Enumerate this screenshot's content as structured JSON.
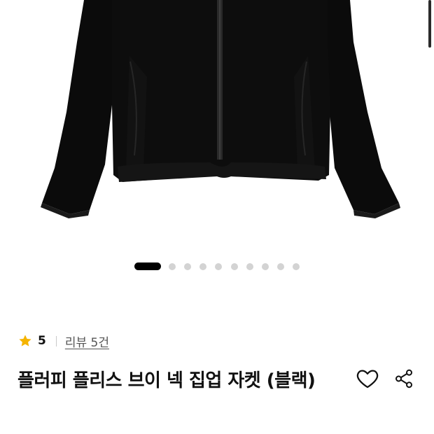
{
  "gallery": {
    "image_alt": "black fleece zip-up jacket",
    "dots_total": 10,
    "active_index": 0
  },
  "rating": {
    "star_icon": "star-icon",
    "value": "5",
    "review_link": "리뷰 5건"
  },
  "product": {
    "title": "플러피 플리스 브이 넥 집업 자켓 (블랙)"
  },
  "actions": {
    "like_icon": "heart-icon",
    "share_icon": "share-icon"
  },
  "colors": {
    "star": "#f5b400",
    "active_dot": "#000000",
    "inactive_dot": "#d3d3d3",
    "jacket": "#0b0b0b"
  }
}
